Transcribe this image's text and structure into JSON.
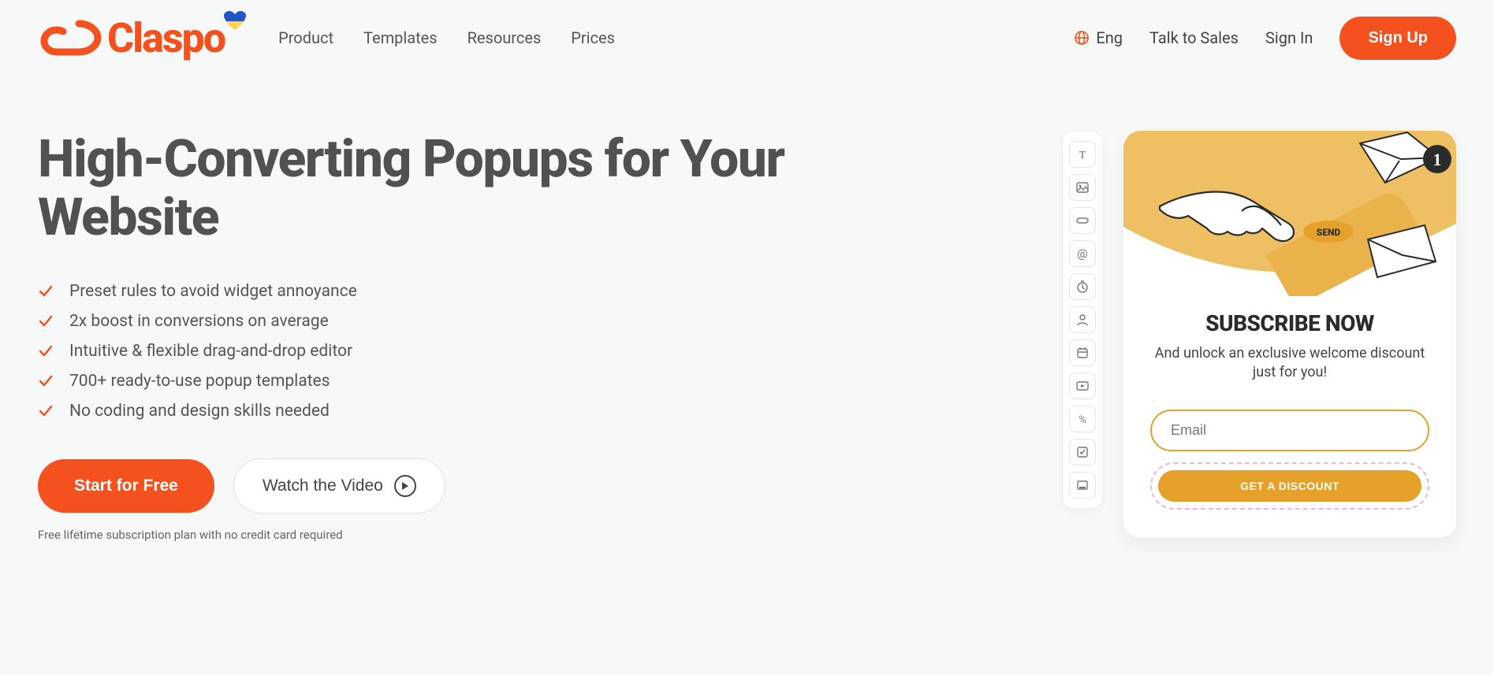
{
  "header": {
    "brand": "Claspo",
    "nav": {
      "product": "Product",
      "templates": "Templates",
      "resources": "Resources",
      "prices": "Prices"
    },
    "lang": "Eng",
    "talk": "Talk to Sales",
    "signin": "Sign In",
    "signup": "Sign Up"
  },
  "hero": {
    "title": "High-Converting Popups for Your Website",
    "bullets": [
      "Preset rules to avoid widget annoyance",
      "2x boost in conversions on average",
      "Intuitive & flexible drag-and-drop editor",
      "700+ ready-to-use popup templates",
      "No coding and design skills needed"
    ],
    "cta_primary": "Start for Free",
    "cta_secondary": "Watch the Video",
    "subtext": "Free lifetime subscription plan with no credit card required"
  },
  "editor": {
    "tools": [
      {
        "name": "text-icon"
      },
      {
        "name": "image-icon"
      },
      {
        "name": "button-icon"
      },
      {
        "name": "email-icon"
      },
      {
        "name": "timer-icon"
      },
      {
        "name": "person-icon"
      },
      {
        "name": "calendar-icon"
      },
      {
        "name": "video-icon"
      },
      {
        "name": "discount-icon"
      },
      {
        "name": "checkbox-icon"
      },
      {
        "name": "container-icon"
      }
    ],
    "popup": {
      "title": "SUBSCRIBE NOW",
      "subtitle": "And unlock an exclusive welcome discount just for you!",
      "placeholder": "Email",
      "button": "GET A DISCOUNT",
      "badge": "1",
      "send": "SEND"
    }
  }
}
